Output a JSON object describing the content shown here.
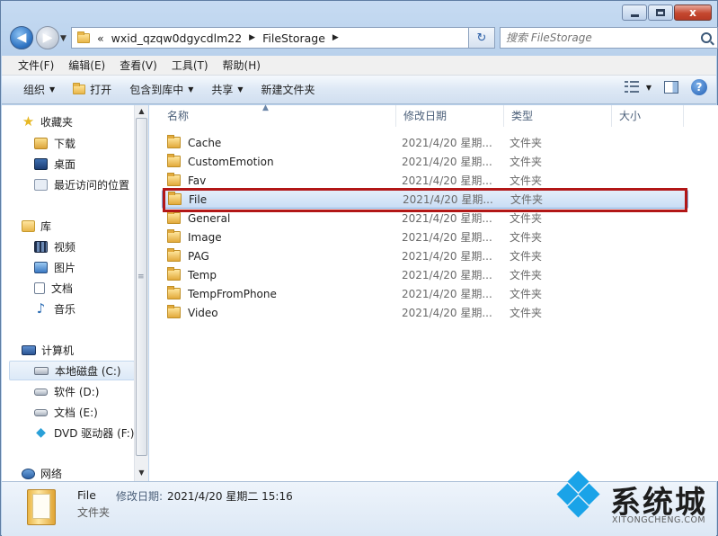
{
  "window": {
    "caption": {
      "close": "x"
    }
  },
  "address": {
    "overflow": "«",
    "crumbs": [
      "wxid_qzqw0dgycdlm22",
      "FileStorage"
    ],
    "refresh_glyph": "↻"
  },
  "search": {
    "placeholder": "搜索 FileStorage"
  },
  "menu": [
    "文件(F)",
    "编辑(E)",
    "查看(V)",
    "工具(T)",
    "帮助(H)"
  ],
  "toolbar": {
    "organize": "组织",
    "open": "打开",
    "include_library": "包含到库中",
    "share": "共享",
    "new_folder": "新建文件夹",
    "help": "?"
  },
  "nav": {
    "favorites": "收藏夹",
    "downloads": "下载",
    "desktop": "桌面",
    "recent": "最近访问的位置",
    "libraries": "库",
    "videos": "视频",
    "pictures": "图片",
    "documents": "文档",
    "music": "音乐",
    "computer": "计算机",
    "drive_c": "本地磁盘 (C:)",
    "drive_d": "软件 (D:)",
    "drive_e": "文档 (E:)",
    "drive_f": "DVD 驱动器 (F:)",
    "network": "网络"
  },
  "columns": [
    "名称",
    "修改日期",
    "类型",
    "大小"
  ],
  "files": [
    {
      "name": "Cache",
      "date": "2021/4/20 星期...",
      "type": "文件夹"
    },
    {
      "name": "CustomEmotion",
      "date": "2021/4/20 星期...",
      "type": "文件夹"
    },
    {
      "name": "Fav",
      "date": "2021/4/20 星期...",
      "type": "文件夹"
    },
    {
      "name": "File",
      "date": "2021/4/20 星期...",
      "type": "文件夹"
    },
    {
      "name": "General",
      "date": "2021/4/20 星期...",
      "type": "文件夹"
    },
    {
      "name": "Image",
      "date": "2021/4/20 星期...",
      "type": "文件夹"
    },
    {
      "name": "PAG",
      "date": "2021/4/20 星期...",
      "type": "文件夹"
    },
    {
      "name": "Temp",
      "date": "2021/4/20 星期...",
      "type": "文件夹"
    },
    {
      "name": "TempFromPhone",
      "date": "2021/4/20 星期...",
      "type": "文件夹"
    },
    {
      "name": "Video",
      "date": "2021/4/20 星期...",
      "type": "文件夹"
    }
  ],
  "selected_index": 3,
  "details": {
    "name": "File",
    "modified_label": "修改日期:",
    "modified_value": "2021/4/20 星期二 15:16",
    "type": "文件夹"
  },
  "watermark": {
    "text": "系统城",
    "url": "XITONGCHENG.COM"
  },
  "colors": {
    "highlight": "#b21717",
    "accent": "#2f74c3",
    "watermark_blue": "#1aa3e8"
  }
}
